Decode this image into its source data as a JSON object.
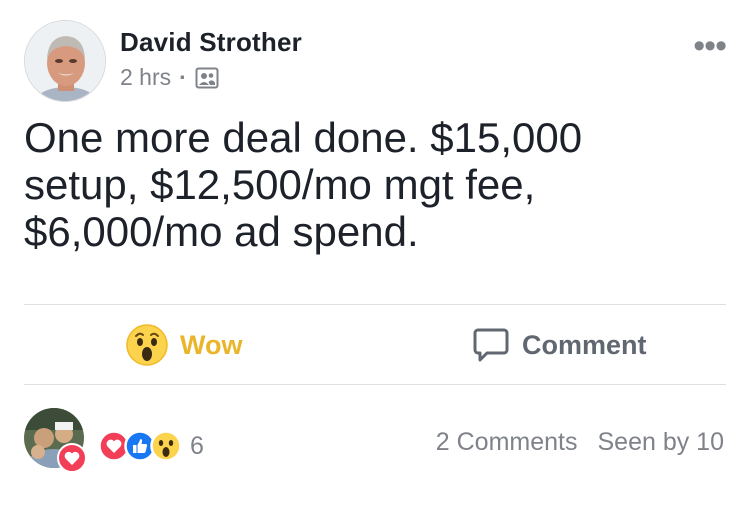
{
  "post": {
    "author": "David Strother",
    "time": "2 hrs",
    "separator": "·",
    "audience_icon": "friends-icon",
    "more_icon": "ellipsis-icon",
    "more_label": "•••",
    "text": "One more deal done. $15,000\nsetup, $12,500/mo mgt fee,\n$6,000/mo ad spend."
  },
  "actions": {
    "wow_label": "Wow",
    "comment_label": "Comment"
  },
  "footer": {
    "reactions": [
      "love-reaction",
      "like-reaction",
      "wow-reaction"
    ],
    "reaction_count": "6",
    "comments": "2 Comments",
    "seen_by": "Seen by 10"
  },
  "colors": {
    "wow": "#e9b52a",
    "love": "#f33e58",
    "like": "#1877f2",
    "muted": "#7f8389"
  }
}
